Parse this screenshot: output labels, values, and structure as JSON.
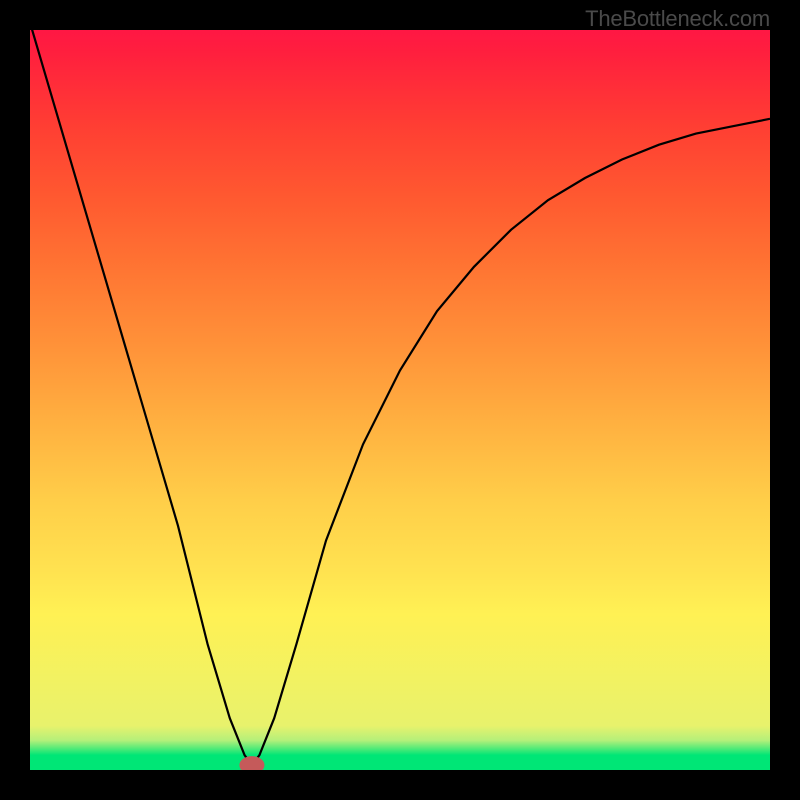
{
  "watermark": "TheBottleneck.com",
  "chart_data": {
    "type": "line",
    "title": "",
    "xlabel": "",
    "ylabel": "",
    "xlim": [
      0,
      100
    ],
    "ylim": [
      0,
      100
    ],
    "series": [
      {
        "name": "curve",
        "x": [
          0,
          5,
          10,
          15,
          20,
          24,
          27,
          29,
          30,
          31,
          33,
          36,
          40,
          45,
          50,
          55,
          60,
          65,
          70,
          75,
          80,
          85,
          90,
          95,
          100
        ],
        "y": [
          101,
          84,
          67,
          50,
          33,
          17,
          7,
          2,
          0.7,
          2,
          7,
          17,
          31,
          44,
          54,
          62,
          68,
          73,
          77,
          80,
          82.5,
          84.5,
          86,
          87,
          88
        ]
      }
    ],
    "marker": {
      "x": 30,
      "y": 0.7,
      "w": 3.4,
      "h": 2.4,
      "color": "#c55a5a"
    },
    "grid": false,
    "legend": false
  },
  "colors": {
    "frame": "#000000",
    "curve": "#000000",
    "marker": "#c55a5a"
  }
}
